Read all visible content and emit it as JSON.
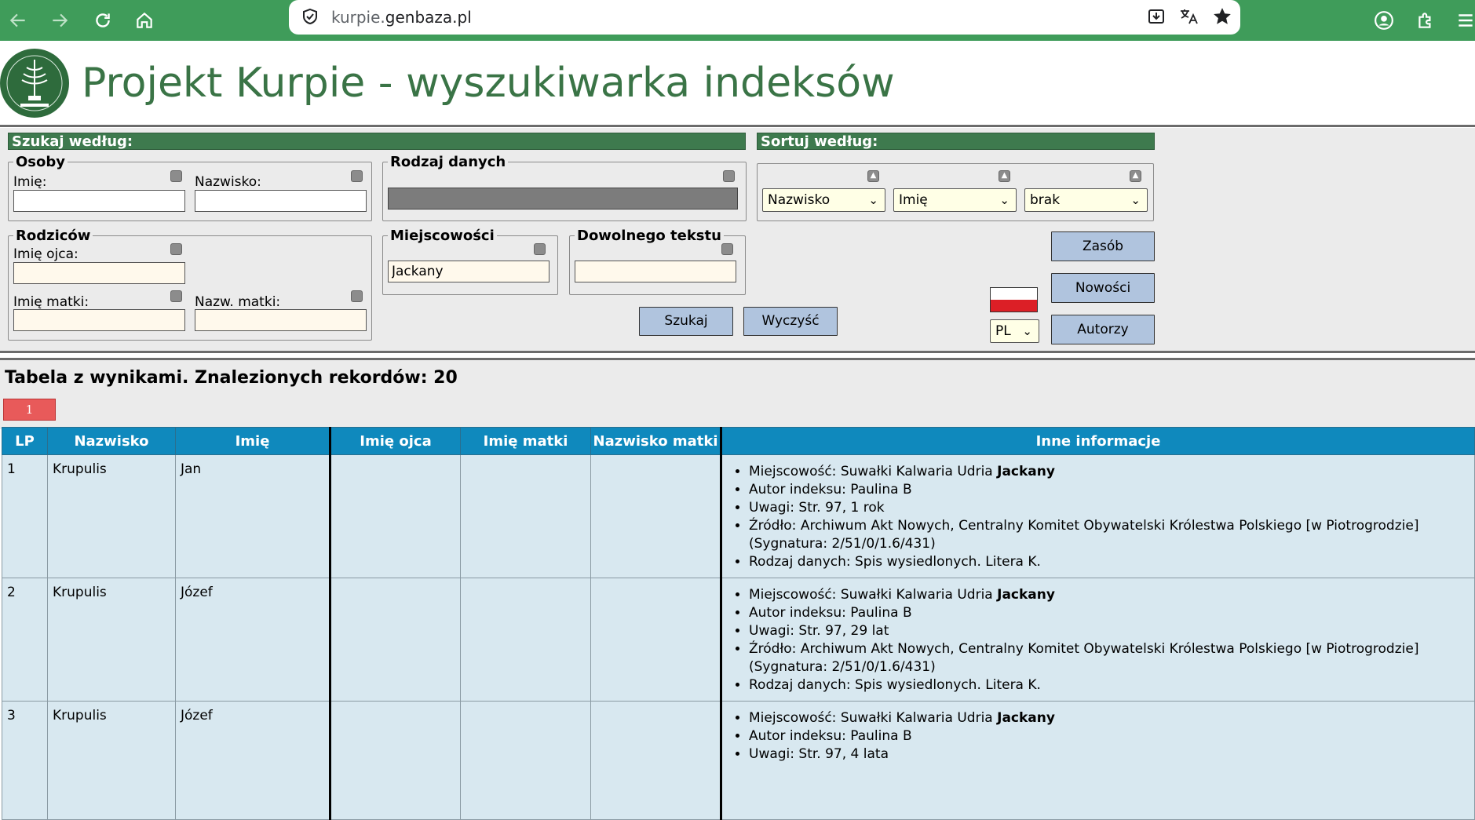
{
  "browser": {
    "url_subdomain": "kurpie.",
    "url_domain": "genbaza.pl"
  },
  "header": {
    "title": "Projekt Kurpie - wyszukiwarka indeksów"
  },
  "search": {
    "section_label": "Szukaj według:",
    "persons": {
      "legend": "Osoby",
      "first_name_label": "Imię:",
      "first_name_value": "",
      "surname_label": "Nazwisko:",
      "surname_value": ""
    },
    "data_type": {
      "legend": "Rodzaj danych"
    },
    "parents": {
      "legend": "Rodziców",
      "father_name_label": "Imię ojca:",
      "mother_name_label": "Imię matki:",
      "mother_surname_label": "Nazw. matki:"
    },
    "places": {
      "legend": "Miejscowości",
      "value": "Jackany"
    },
    "any_text": {
      "legend": "Dowolnego tekstu",
      "value": ""
    },
    "search_button": "Szukaj",
    "clear_button": "Wyczyść"
  },
  "sort": {
    "section_label": "Sortuj według:",
    "select1": "Nazwisko",
    "select2": "Imię",
    "select3": "brak"
  },
  "side_buttons": {
    "resource": "Zasób",
    "news": "Nowości",
    "authors": "Autorzy"
  },
  "language": {
    "value": "PL"
  },
  "results": {
    "title": "Tabela z wynikami. Znalezionych rekordów: 20",
    "current_page": "1",
    "columns": [
      "LP",
      "Nazwisko",
      "Imię",
      "Imię ojca",
      "Imię matki",
      "Nazwisko matki",
      "Inne informacje"
    ],
    "rows": [
      {
        "lp": "1",
        "surname": "Krupulis",
        "first_name": "Jan",
        "father": "",
        "mother": "",
        "mother_surname": "",
        "info": {
          "place_label": "Miejscowość: Suwałki Kalwaria Udria ",
          "place_bold": "Jackany",
          "author": "Autor indeksu: Paulina B",
          "notes": "Uwagi: Str. 97, 1 rok",
          "source": "Źródło: Archiwum Akt Nowych, Centralny Komitet Obywatelski Królestwa Polskiego [w Piotrogrodzie] (Sygnatura: 2/51/0/1.6/431)",
          "data_type": "Rodzaj danych: Spis wysiedlonych. Litera K."
        }
      },
      {
        "lp": "2",
        "surname": "Krupulis",
        "first_name": "Józef",
        "father": "",
        "mother": "",
        "mother_surname": "",
        "info": {
          "place_label": "Miejscowość: Suwałki Kalwaria Udria ",
          "place_bold": "Jackany",
          "author": "Autor indeksu: Paulina B",
          "notes": "Uwagi: Str. 97, 29 lat",
          "source": "Źródło: Archiwum Akt Nowych, Centralny Komitet Obywatelski Królestwa Polskiego [w Piotrogrodzie] (Sygnatura: 2/51/0/1.6/431)",
          "data_type": "Rodzaj danych: Spis wysiedlonych. Litera K."
        }
      },
      {
        "lp": "3",
        "surname": "Krupulis",
        "first_name": "Józef",
        "father": "",
        "mother": "",
        "mother_surname": "",
        "info": {
          "place_label": "Miejscowość: Suwałki Kalwaria Udria ",
          "place_bold": "Jackany",
          "author": "Autor indeksu: Paulina B",
          "notes": "Uwagi: Str. 97, 4 lata"
        }
      }
    ]
  }
}
